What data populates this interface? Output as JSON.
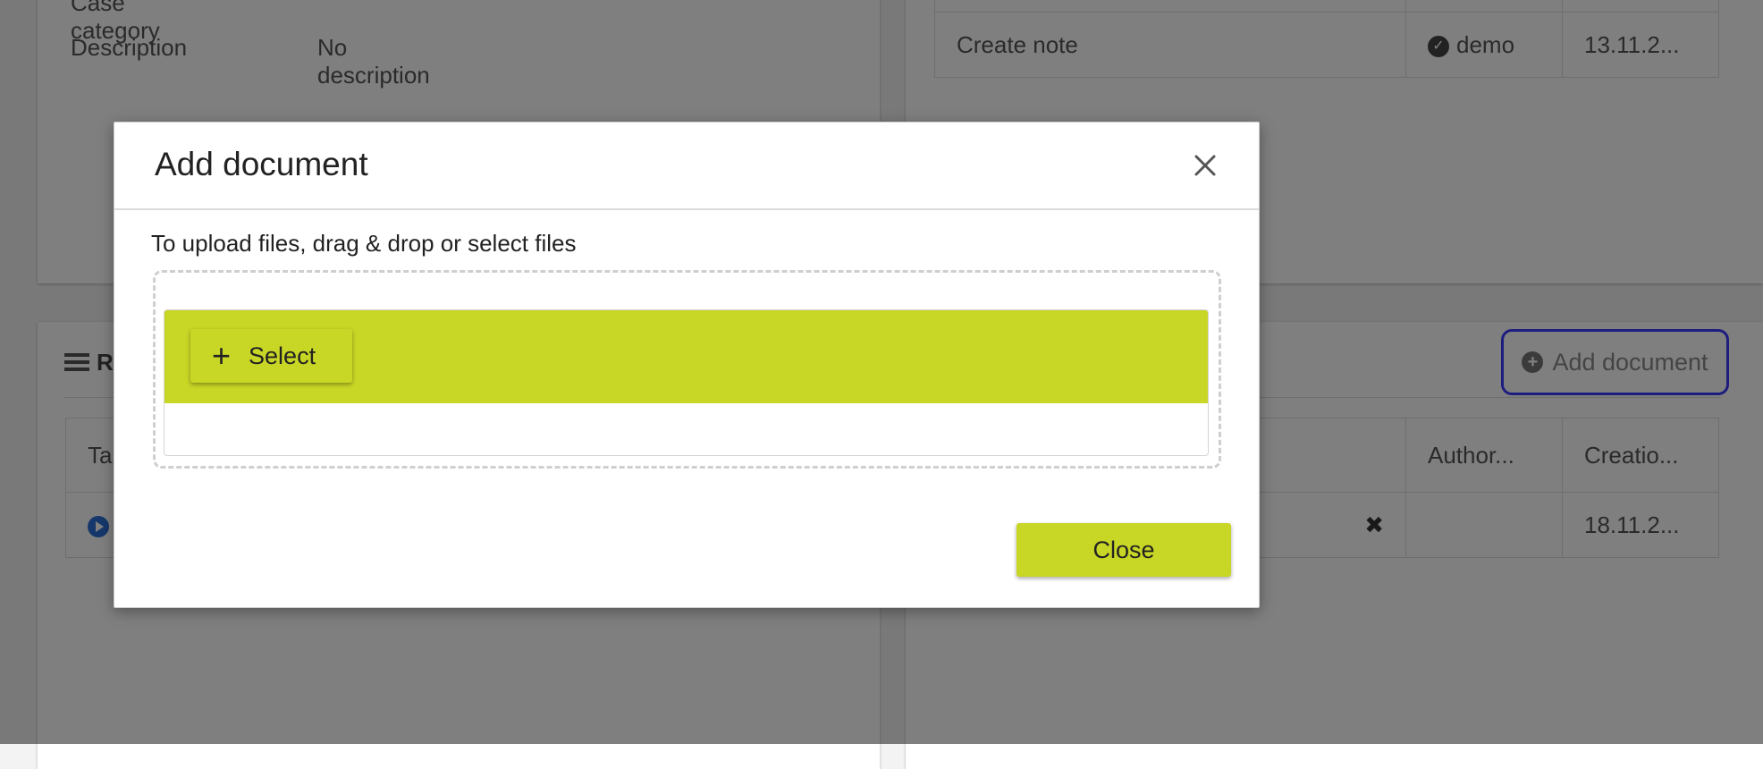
{
  "background": {
    "case_info": {
      "partial_label": "Case category",
      "description_label": "Description",
      "description_value": "No description"
    },
    "history_table": {
      "row": {
        "action": "Create note",
        "user": "demo",
        "date": "13.11.2..."
      }
    },
    "related_panel": {
      "title_partial": "R",
      "table_header_partial": "Ta"
    },
    "add_document_button": {
      "label": "Add document"
    },
    "documents_table": {
      "headers": {
        "author": "Author...",
        "creation": "Creatio..."
      },
      "row": {
        "date": "18.11.2..."
      }
    }
  },
  "modal": {
    "title": "Add document",
    "instruction": "To upload files, drag & drop or select files",
    "select_button": "Select",
    "close_button": "Close",
    "accent_color": "#c8d626"
  }
}
